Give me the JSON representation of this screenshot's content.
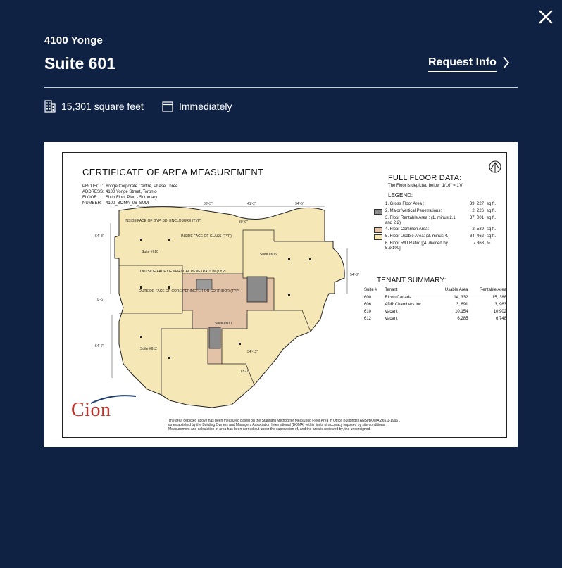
{
  "header": {
    "building_name": "4100 Yonge",
    "suite_title": "Suite 601",
    "request_info_label": "Request Info"
  },
  "meta": {
    "area": "15,301 square feet",
    "availability": "Immediately"
  },
  "colors": {
    "background": "#0f2244",
    "text": "#ffffff",
    "floor_usable": "#f6e7b6",
    "floor_common": "#e3c3a7",
    "vertical_penetration": "#8b8b8b",
    "brand_red": "#c4312a"
  },
  "icons": {
    "close": "close-icon",
    "chevron": "chevron-right-icon",
    "building": "building-icon",
    "calendar": "calendar-icon"
  },
  "floorplan": {
    "title": "CERTIFICATE OF AREA MEASUREMENT",
    "project_rows": [
      {
        "k": "PROJECT:",
        "v": "Yonge Corporate Centre, Phase Three"
      },
      {
        "k": "ADDRESS:",
        "v": "4100 Yonge Street, Toronto"
      },
      {
        "k": "FLOOR:",
        "v": "Sixth Floor Plan - Summary"
      },
      {
        "k": "NUMBER:",
        "v": "4100_BOMA_06_SUM"
      }
    ],
    "full_floor_heading": "FULL FLOOR DATA:",
    "scale_note": "The Floor is depicted below",
    "scale_value": "1/16\" = 1'0\"",
    "legend_heading": "LEGEND:",
    "legend": [
      {
        "label": "1.  Gross Floor Area :",
        "value": "39, 227",
        "unit": "sq.ft.",
        "swatch": "none"
      },
      {
        "label": "2.  Major Vertical Penetrations:",
        "value": "2, 226",
        "unit": "sq.ft.",
        "swatch": "#8b8b8b"
      },
      {
        "label": "3.  Floor Rentable Area : (1. minus 2.1 and 2.2)",
        "value": "37, 001",
        "unit": "sq.ft.",
        "swatch": "none"
      },
      {
        "label": "4.  Floor Common Area:",
        "value": "2, 539",
        "unit": "sq.ft.",
        "swatch": "#e3c3a7"
      },
      {
        "label": "5.  Floor Usable Area: (3. minus 4.)",
        "value": "34, 462",
        "unit": "sq.ft.",
        "swatch": "#f6e7b6"
      },
      {
        "label": "6.  Floor R/U Ratio: [(4. divided by 5.)x100]",
        "value": "7.368",
        "unit": "%",
        "swatch": "none"
      }
    ],
    "tenant_heading": "TENANT SUMMARY:",
    "tenant_columns": [
      "Suite #",
      "Tenant",
      "Usable Area",
      "Rentable Area"
    ],
    "tenants": [
      {
        "suite": "600",
        "tenant": "Ricoh Canada",
        "usable": "14, 332",
        "rentable": "15, 388"
      },
      {
        "suite": "606",
        "tenant": "ADR Chambers Inc.",
        "usable": "3, 691",
        "rentable": "3, 963"
      },
      {
        "suite": "610",
        "tenant": "Vacant",
        "usable": "10,154",
        "rentable": "10,902"
      },
      {
        "suite": "612",
        "tenant": "Vacant",
        "usable": "6,285",
        "rentable": "6,748"
      }
    ],
    "logo_text": "Cion",
    "footnote": "The area depicted above has been measured based on the Standard Method for Measuring Floor Area in Office Buildings (ANSI/BOMA Z65.1-1996), as established by the Building Owners and Managers Association International (BOMA) within limits of accuracy imposed by site conditions. Measurement and calculation of area has been carried out under the supervision of, and the area is reviewed by, the undersigned.",
    "room_labels": {
      "suite_610": "Suite #610",
      "suite_606": "Suite #606",
      "suite_600": "Suite #600",
      "suite_612": "Suite #612",
      "inside_glass": "INSIDE FACE OF GLASS (TYP)",
      "outside_core": "OUTSIDE FACE OF CORE PERIMETER OR CORRIDOR (TYP)",
      "outside_vertical": "OUTSIDE FACE OF VERTICAL PENETRATION (TYP)",
      "inside_gyp": "INSIDE FACE OF GYP. BD. ENCLOSURE (TYP)"
    },
    "dimensions": [
      "63'-3\"",
      "41'-2\"",
      "34'-5\"",
      "54'-8\"",
      "54'-3\"",
      "54'-7\"",
      "70'-6\"",
      "30'-0\"",
      "13'-0\"",
      "34'-11\""
    ]
  }
}
